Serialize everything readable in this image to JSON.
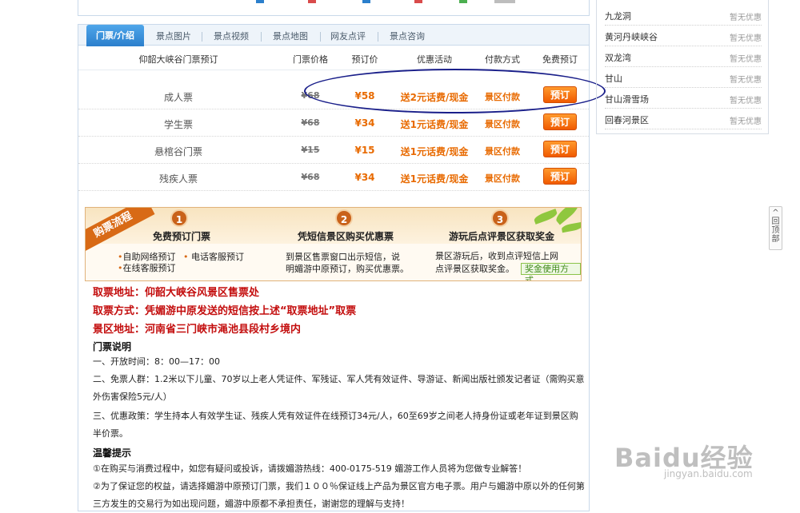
{
  "tabs": [
    "门票/介绍",
    "景点图片",
    "景点视频",
    "景点地图",
    "网友点评",
    "景点咨询"
  ],
  "table": {
    "headers": [
      "仰韶大峡谷门票预订",
      "门票价格",
      "预订价",
      "优惠活动",
      "付款方式",
      "免费预订"
    ],
    "rows": [
      {
        "name": "成人票",
        "orig": "¥68",
        "price": "¥58",
        "promo": "送2元话费/现金",
        "pay": "景区付款",
        "button": "预订"
      },
      {
        "name": "学生票",
        "orig": "¥68",
        "price": "¥34",
        "promo": "送1元话费/现金",
        "pay": "景区付款",
        "button": "预订"
      },
      {
        "name": "悬棺谷门票",
        "orig": "¥15",
        "price": "¥15",
        "promo": "送1元话费/现金",
        "pay": "景区付款",
        "button": "预订"
      },
      {
        "name": "残疾人票",
        "orig": "¥68",
        "price": "¥34",
        "promo": "送1元话费/现金",
        "pay": "景区付款",
        "button": "预订"
      }
    ]
  },
  "process": {
    "ribbon": "购票流程",
    "steps": [
      {
        "num": "1",
        "title": "免费预订门票",
        "lines": [
          "自助网络预订",
          "电话客服预订",
          "在线客服预订"
        ]
      },
      {
        "num": "2",
        "title": "凭短信景区购买优惠票",
        "lines": [
          "到景区售票窗口出示短信，说",
          "明媚游中原预订，购买优惠票。"
        ]
      },
      {
        "num": "3",
        "title": "游玩后点评景区获取奖金",
        "lines": [
          "景区游玩后，收到点评短信上网",
          "点评景区获取奖金。"
        ]
      }
    ],
    "prize_link": "奖金使用方式"
  },
  "info": {
    "pickup_addr": "取票地址：仰韶大峡谷风景区售票处",
    "pickup_method": "取票方式：凭媚游中原发送的短信按上述“取票地址”取票",
    "scenic_addr": "景区地址：河南省三门峡市渑池县段村乡境内",
    "ticket_title": "门票说明",
    "ticket_lines": [
      "一、开放时间：8：00—17：00",
      "二、免票人群：1.2米以下儿童、70岁以上老人凭证件、军残证、军人凭有效证件、导游证、新闻出版社颁发记者证（需购买意外伤害保险5元/人）",
      "三、优惠政策：学生持本人有效学生证、残疾人凭有效证件在线预订34元/人，60至69岁之间老人持身份证或老年证到景区购半价票。"
    ],
    "tips_title": "温馨提示",
    "tips_lines": [
      "①在购买与消费过程中，如您有疑问或投诉，请拨媚游热线：400-0175-519 媚游工作人员将为您做专业解答！",
      "②为了保证您的权益，请选择媚游中原预订门票，我们１００％保证线上产品为景区官方电子票。用户与媚游中原以外的任何第三方发生的交易行为如出现问题，媚游中原都不承担责任，谢谢您的理解与支持！"
    ]
  },
  "sidebar": [
    {
      "name": "九龙洞",
      "status": "暂无优惠"
    },
    {
      "name": "黄河丹峡峡谷",
      "status": "暂无优惠"
    },
    {
      "name": "双龙湾",
      "status": "暂无优惠"
    },
    {
      "name": "甘山",
      "status": "暂无优惠"
    },
    {
      "name": "甘山滑雪场",
      "status": "暂无优惠"
    },
    {
      "name": "回春河景区",
      "status": "暂无优惠"
    }
  ],
  "back_to_top": "回顶部",
  "watermark": {
    "logo": "Baidu经验",
    "url": "jingyan.baidu.com"
  },
  "colors": {
    "accent": "#2b7fcc",
    "orange": "#e86a00",
    "red": "#c30d0d",
    "annotation": "#1a1f8a"
  }
}
